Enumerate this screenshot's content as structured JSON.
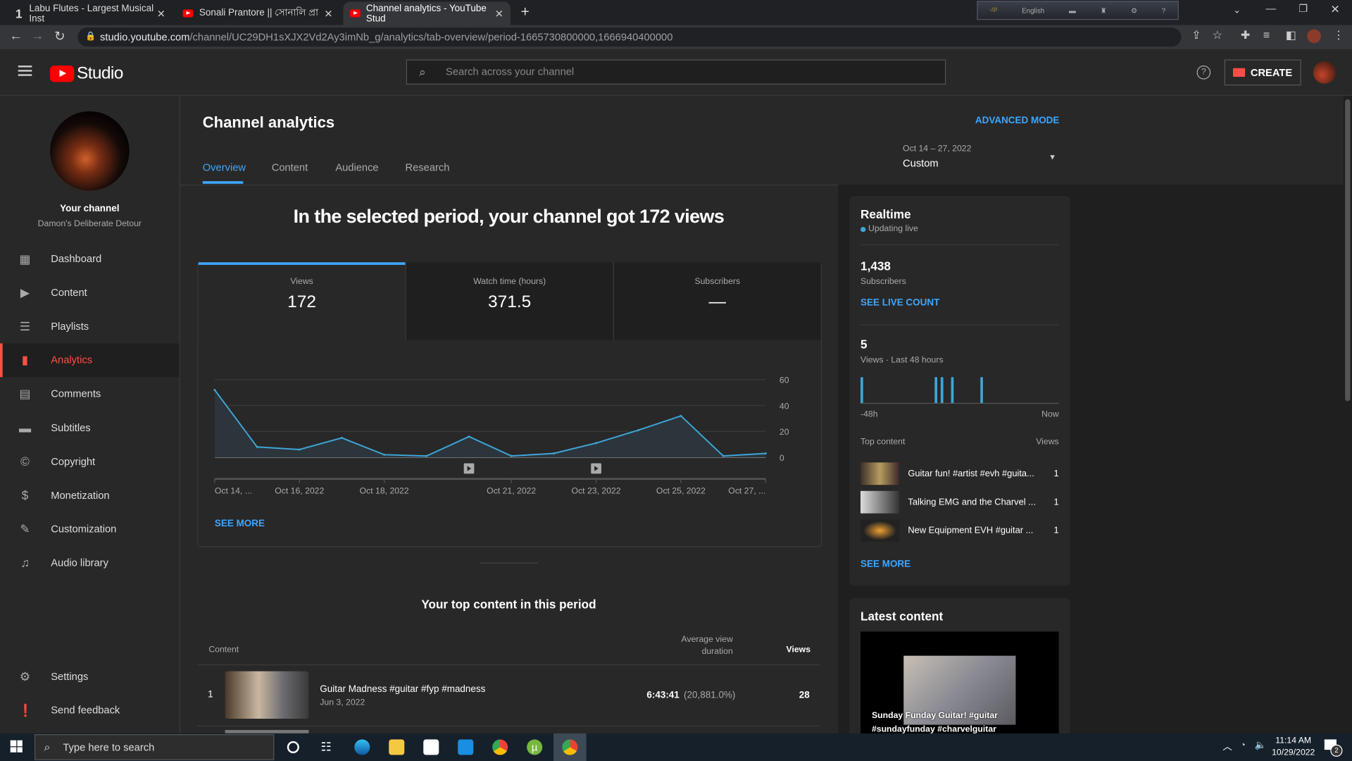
{
  "browser": {
    "tabs": [
      {
        "title": "Labu Flutes - Largest Musical Inst"
      },
      {
        "title": "Sonali Prantore || সোনালি প্রা"
      },
      {
        "title": "Channel analytics - YouTube Stud"
      }
    ],
    "url_host": "studio.youtube.com",
    "url_path": "/channel/UC29DH1sXJX2Vd2Ay3imNb_g/analytics/tab-overview/period-1665730800000,1666940400000",
    "ime_language": "English"
  },
  "header": {
    "logo": "Studio",
    "search_placeholder": "Search across your channel",
    "create_label": "CREATE"
  },
  "sidebar": {
    "channel_label": "Your channel",
    "channel_name": "Damon's Deliberate Detour",
    "items": [
      {
        "label": "Dashboard",
        "icon": "dashboard-icon"
      },
      {
        "label": "Content",
        "icon": "content-icon"
      },
      {
        "label": "Playlists",
        "icon": "playlists-icon"
      },
      {
        "label": "Analytics",
        "icon": "analytics-icon",
        "active": true
      },
      {
        "label": "Comments",
        "icon": "comments-icon"
      },
      {
        "label": "Subtitles",
        "icon": "subtitles-icon"
      },
      {
        "label": "Copyright",
        "icon": "copyright-icon"
      },
      {
        "label": "Monetization",
        "icon": "dollar-icon"
      },
      {
        "label": "Customization",
        "icon": "customization-icon"
      },
      {
        "label": "Audio library",
        "icon": "audio-library-icon"
      }
    ],
    "settings": "Settings",
    "feedback": "Send feedback"
  },
  "main": {
    "title": "Channel analytics",
    "advanced_mode": "ADVANCED MODE",
    "tabs": [
      "Overview",
      "Content",
      "Audience",
      "Research"
    ],
    "date_range": "Oct 14 – 27, 2022",
    "date_preset": "Custom",
    "headline": "In the selected period, your channel got 172 views",
    "metrics": [
      {
        "label": "Views",
        "value": "172"
      },
      {
        "label": "Watch time (hours)",
        "value": "371.5"
      },
      {
        "label": "Subscribers",
        "value": "—"
      }
    ],
    "see_more": "SEE MORE",
    "top_content_title": "Your top content in this period",
    "table": {
      "headers": {
        "content": "Content",
        "avg_line1": "Average view",
        "avg_line2": "duration",
        "views": "Views"
      },
      "rows": [
        {
          "rank": "1",
          "title": "Guitar Madness #guitar #fyp #madness",
          "date": "Jun 3, 2022",
          "avg_duration": "6:43:41",
          "avg_pct": "(20,881.0%)",
          "views": "28"
        }
      ]
    }
  },
  "chart_data": {
    "type": "area",
    "title": "Views",
    "x": [
      "Oct 14",
      "Oct 15",
      "Oct 16",
      "Oct 17",
      "Oct 18",
      "Oct 19",
      "Oct 20",
      "Oct 21",
      "Oct 22",
      "Oct 23",
      "Oct 24",
      "Oct 25",
      "Oct 26",
      "Oct 27"
    ],
    "values": [
      52,
      8,
      6,
      15,
      2,
      1,
      16,
      1,
      3,
      11,
      21,
      32,
      1,
      3
    ],
    "x_tick_labels": [
      {
        "index": 0,
        "label": "Oct 14, ..."
      },
      {
        "index": 2,
        "label": "Oct 16, 2022"
      },
      {
        "index": 4,
        "label": "Oct 18, 2022"
      },
      {
        "index": 7,
        "label": "Oct 21, 2022"
      },
      {
        "index": 9,
        "label": "Oct 23, 2022"
      },
      {
        "index": 11,
        "label": "Oct 25, 2022"
      },
      {
        "index": 13,
        "label": "Oct 27, ..."
      }
    ],
    "y_ticks": [
      0,
      20,
      40,
      60
    ],
    "ylim": [
      0,
      60
    ],
    "video_markers_at_index": [
      6,
      9
    ],
    "color": "#3ea6d8"
  },
  "realtime": {
    "title": "Realtime",
    "status": "Updating live",
    "subscribers": "1,438",
    "subscribers_label": "Subscribers",
    "see_live": "SEE LIVE COUNT",
    "views": "5",
    "views_label": "Views · Last 48 hours",
    "bars_hours_ago": [
      48,
      30,
      28.5,
      26,
      19
    ],
    "axis_start": "-48h",
    "axis_end": "Now",
    "top_content_label": "Top content",
    "views_col": "Views",
    "items": [
      {
        "title": "Guitar fun! #artist #evh #guita...",
        "views": "1"
      },
      {
        "title": "Talking EMG and the Charvel ...",
        "views": "1"
      },
      {
        "title": "New Equipment EVH #guitar ...",
        "views": "1"
      }
    ],
    "see_more": "SEE MORE"
  },
  "latest": {
    "title": "Latest content",
    "video_title": "Sunday Funday Guitar! #guitar #sundayfunday #charvelguitar"
  },
  "taskbar": {
    "search": "Type here to search",
    "time": "11:14 AM",
    "date": "10/29/2022",
    "notifications": "2"
  }
}
